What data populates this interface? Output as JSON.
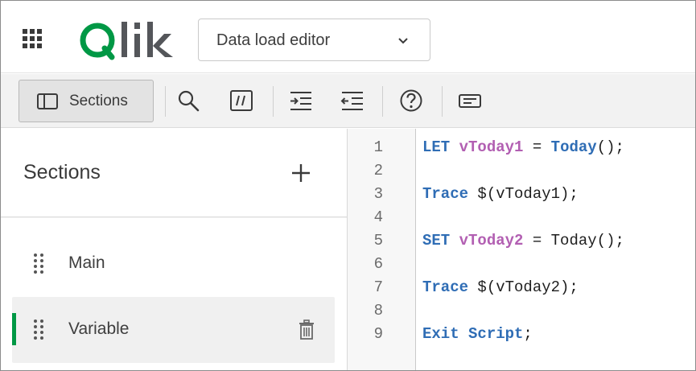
{
  "app": {
    "logo_text": "Qlik",
    "view_selector": {
      "selected": "Data load editor"
    },
    "brand_color": "#009845"
  },
  "toolbar": {
    "sections_label": "Sections",
    "icons": [
      "search-icon",
      "comment-icon",
      "indent-icon",
      "outdent-icon",
      "help-icon",
      "debug-panel-icon"
    ]
  },
  "sections_panel": {
    "title": "Sections",
    "items": [
      {
        "label": "Main",
        "selected": false
      },
      {
        "label": "Variable",
        "selected": true
      }
    ]
  },
  "editor": {
    "line_numbers": [
      "1",
      "2",
      "3",
      "4",
      "5",
      "6",
      "7",
      "8",
      "9"
    ],
    "lines": [
      {
        "keyword": "LET",
        "variable": "vToday1",
        "op": " = ",
        "func": "Today",
        "rest": "();"
      },
      {
        "text": ""
      },
      {
        "keyword": "Trace",
        "rest": " $(vToday1);"
      },
      {
        "text": ""
      },
      {
        "keyword": "SET",
        "variable": "vToday2",
        "rest": " = Today();"
      },
      {
        "text": ""
      },
      {
        "keyword": "Trace",
        "rest": " $(vToday2);"
      },
      {
        "text": ""
      },
      {
        "keyword": "Exit Script",
        "rest": ";"
      }
    ],
    "colors": {
      "keyword": "#2f6db5",
      "variable": "#b25fb2"
    }
  }
}
